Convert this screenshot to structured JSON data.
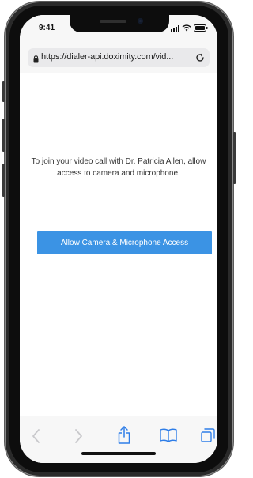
{
  "status_bar": {
    "time": "9:41"
  },
  "browser": {
    "url": "https://dialer-api.doximity.com/vid...",
    "lock_icon": "lock-icon",
    "reload_icon": "reload-icon",
    "toolbar": {
      "back_icon": "chevron-left-icon",
      "forward_icon": "chevron-right-icon",
      "share_icon": "share-icon",
      "bookmarks_icon": "book-icon",
      "tabs_icon": "tabs-icon"
    }
  },
  "page": {
    "message": "To join your video call with Dr. Patricia Allen, allow access to camera and microphone.",
    "allow_button_label": "Allow Camera & Microphone Access",
    "accent_color": "#3b93e4",
    "toolbar_icon_color": "#2f7ee8"
  }
}
